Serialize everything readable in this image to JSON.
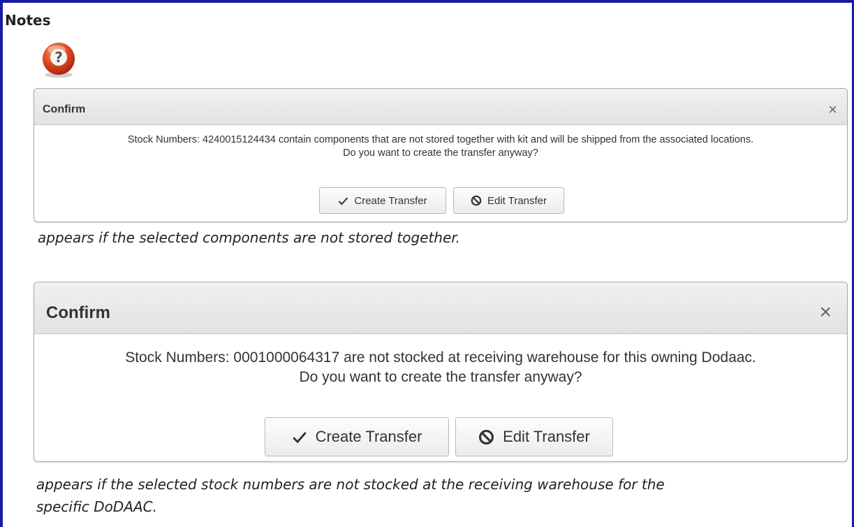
{
  "notes_title": "Notes",
  "help_icon": "question-mark-icon",
  "dialog1": {
    "title": "Confirm",
    "close": "×",
    "message_line1": "Stock Numbers: 4240015124434 contain components that are not stored together with kit and will be shipped from the associated locations.",
    "message_line2": "Do you want to create the transfer anyway?",
    "create_label": "Create Transfer",
    "edit_label": "Edit Transfer"
  },
  "note1": "appears if the selected components are not stored together.",
  "dialog2": {
    "title": "Confirm",
    "close": "×",
    "message_line1": "Stock Numbers: 0001000064317 are not stocked at receiving warehouse for this owning Dodaac.",
    "message_line2": "Do you want to create the transfer anyway?",
    "create_label": "Create Transfer",
    "edit_label": "Edit Transfer"
  },
  "note2_line1": "appears if the selected stock numbers are not stocked at the receiving warehouse for the",
  "note2_line2": "specific DoDAAC.",
  "colors": {
    "frame_border": "#1a1aa6",
    "icon_red": "#d0402a"
  }
}
